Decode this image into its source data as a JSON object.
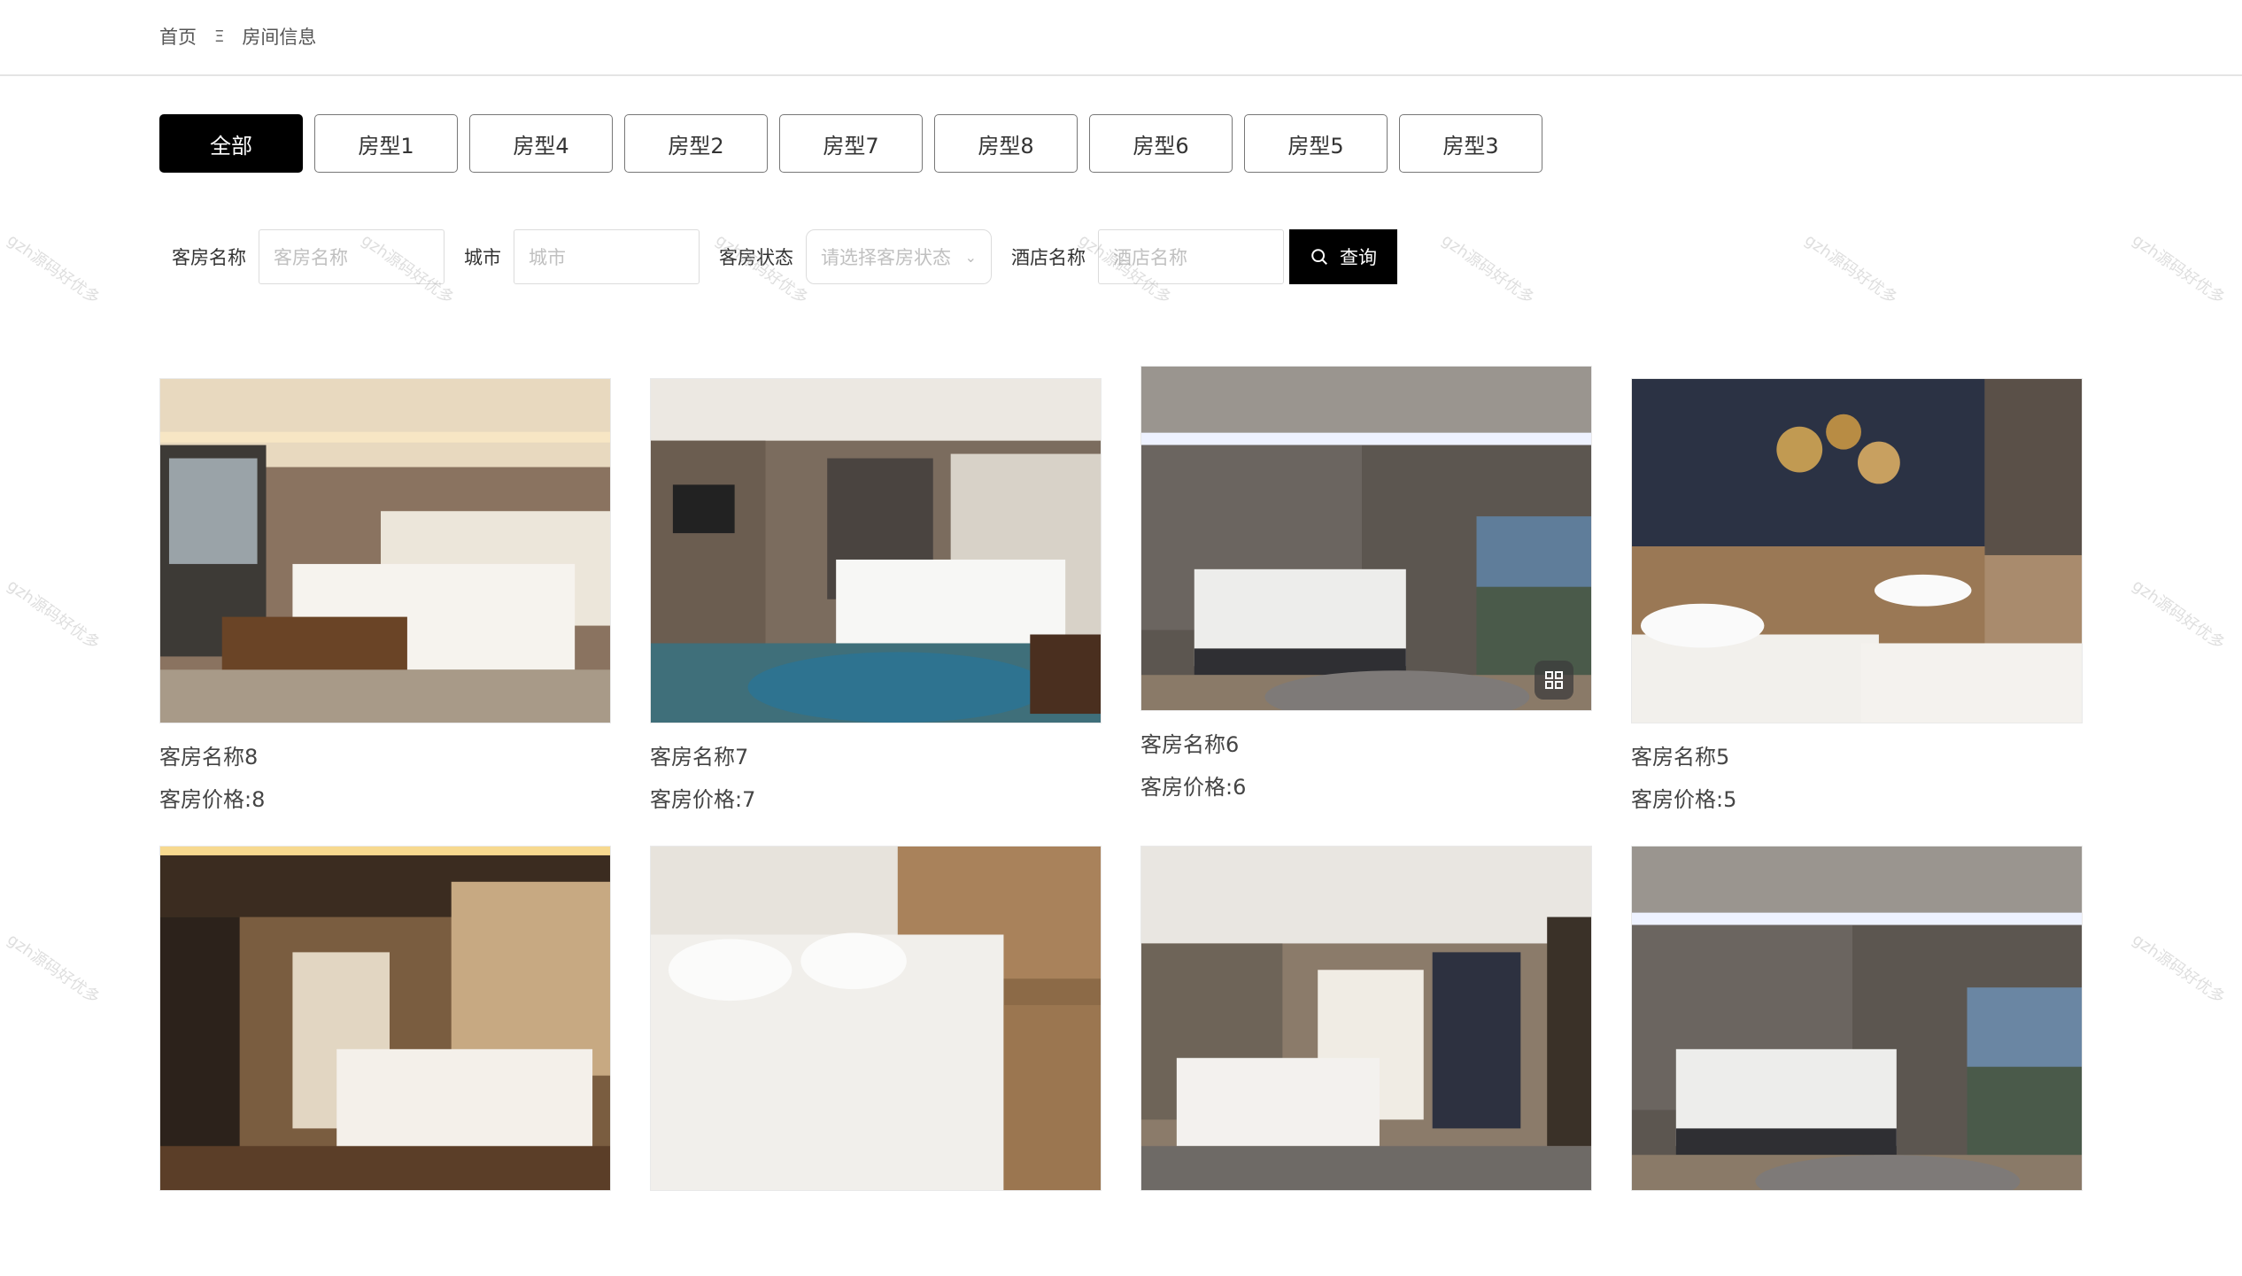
{
  "breadcrumb": {
    "home": "首页",
    "separator": "Ξ",
    "current": "房间信息"
  },
  "tabs": [
    {
      "label": "全部",
      "active": true
    },
    {
      "label": "房型1",
      "active": false
    },
    {
      "label": "房型4",
      "active": false
    },
    {
      "label": "房型2",
      "active": false
    },
    {
      "label": "房型7",
      "active": false
    },
    {
      "label": "房型8",
      "active": false
    },
    {
      "label": "房型6",
      "active": false
    },
    {
      "label": "房型5",
      "active": false
    },
    {
      "label": "房型3",
      "active": false
    }
  ],
  "filters": {
    "room_name_label": "客房名称",
    "room_name_placeholder": "客房名称",
    "city_label": "城市",
    "city_placeholder": "城市",
    "status_label": "客房状态",
    "status_placeholder": "请选择客房状态",
    "hotel_name_label": "酒店名称",
    "hotel_name_placeholder": "酒店名称",
    "search_label": "查询"
  },
  "rooms": [
    {
      "name": "客房名称8",
      "price": "客房价格:8"
    },
    {
      "name": "客房名称7",
      "price": "客房价格:7"
    },
    {
      "name": "客房名称6",
      "price": "客房价格:6"
    },
    {
      "name": "客房名称5",
      "price": "客房价格:5"
    },
    {
      "name": "",
      "price": ""
    },
    {
      "name": "",
      "price": ""
    },
    {
      "name": "",
      "price": ""
    },
    {
      "name": "",
      "price": ""
    }
  ],
  "watermark": "gzh源码好优多",
  "colors": {
    "accent": "#000000",
    "border": "#dcdcdc"
  }
}
